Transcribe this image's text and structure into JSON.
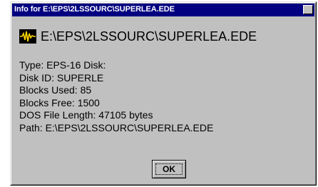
{
  "window": {
    "title": "Info for E:\\EPS\\2LSSOURC\\SUPERLEA.EDE"
  },
  "header": {
    "icon": "waveform-icon",
    "path": "E:\\EPS\\2LSSOURC\\SUPERLEA.EDE"
  },
  "info": {
    "type": "Type: EPS-16 Disk:",
    "disk_id": "Disk ID: SUPERLE",
    "blocks_used": "Blocks Used: 85",
    "blocks_free": "Blocks Free: 1500",
    "dos_length": "DOS File Length: 47105 bytes",
    "path": "Path: E:\\EPS\\2LSSOURC\\SUPERLEA.EDE"
  },
  "buttons": {
    "ok_label": "OK"
  },
  "colors": {
    "titlebar": "#000080",
    "face": "#c0c0c0",
    "icon_bg": "#000000",
    "icon_wave": "#ffd700"
  }
}
